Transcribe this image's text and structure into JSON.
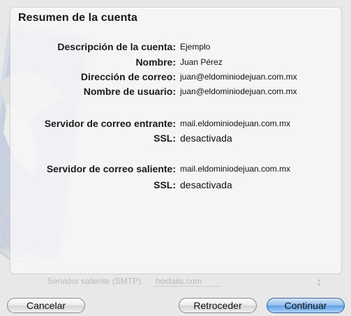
{
  "sheet": {
    "title": "Resumen de la cuenta"
  },
  "account": {
    "rows": [
      {
        "label": "Descripción de la cuenta:",
        "value": "Ejemplo"
      },
      {
        "label": "Nombre:",
        "value": "Juan Pérez"
      },
      {
        "label": "Dirección de correo:",
        "value": "juan@eldominiodejuan.com.mx"
      },
      {
        "label": "Nombre de usuario:",
        "value": "juan@eldominiodejuan.com.mx"
      }
    ]
  },
  "incoming": {
    "server_label": "Servidor de correo entrante:",
    "server_value": "mail.eldominiodejuan.com.mx",
    "ssl_label": "SSL:",
    "ssl_value": "desactivada"
  },
  "outgoing": {
    "server_label": "Servidor de correo saliente:",
    "server_value": "mail.eldominiodejuan.com.mx",
    "ssl_label": "SSL:",
    "ssl_value": "desactivada"
  },
  "background": {
    "ghost_label": "Servidor saliente (SMTP):",
    "ghost_value": "hostalis.com",
    "icon": "mail-stamp-eagle"
  },
  "buttons": {
    "cancel": "Cancelar",
    "back": "Retroceder",
    "continue": "Continuar"
  },
  "colors": {
    "primary_button": "#5f9ee6"
  }
}
